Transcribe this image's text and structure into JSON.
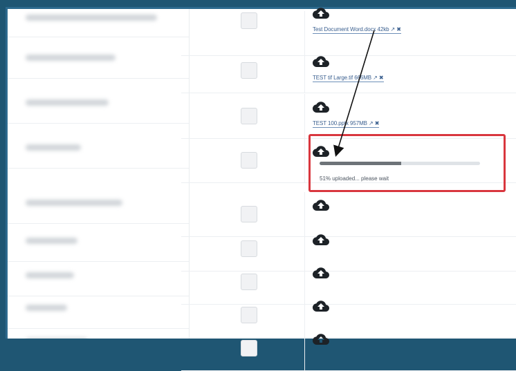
{
  "rows": [
    {
      "file_link": "Test Document Word.docx 42kb ↗ ✖"
    },
    {
      "file_link": "TEST tif Large.tif 666MB ↗ ✖"
    },
    {
      "file_link": "TEST 100.pptx 957MB ↗ ✖"
    },
    {
      "file_link": ""
    },
    {
      "file_link": ""
    },
    {
      "file_link": ""
    },
    {
      "file_link": ""
    },
    {
      "file_link": ""
    },
    {
      "file_link": ""
    }
  ],
  "upload": {
    "progress_percent": 51,
    "status_text": "51% uploaded... please wait"
  },
  "icons": {
    "upload": "cloud-upload-icon",
    "checkbox": "checkbox"
  },
  "colors": {
    "highlight": "#d9363e",
    "frame_border": "#2d6a8e",
    "link": "#3a5f8f"
  }
}
